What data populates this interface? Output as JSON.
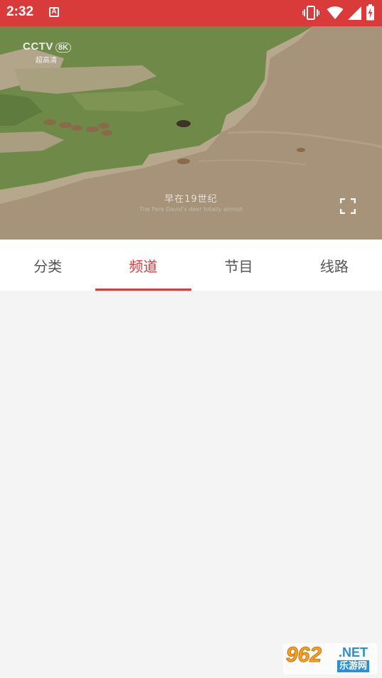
{
  "status_bar": {
    "time": "2:32",
    "notification_icon": "A",
    "color": "#d93a3a"
  },
  "video": {
    "logo_brand": "CCTV",
    "logo_resolution": "8K",
    "logo_sub": "超高清",
    "subtitle": "早在19世纪",
    "subtitle_en": "The Pere David's deer totally almost"
  },
  "tabs": [
    {
      "label": "分类",
      "active": false
    },
    {
      "label": "频道",
      "active": true
    },
    {
      "label": "节目",
      "active": false
    },
    {
      "label": "线路",
      "active": false
    }
  ],
  "accent_color": "#d93a3a",
  "watermark": {
    "number": "962",
    "suffix": ".NET",
    "cn_text": "乐游网"
  }
}
